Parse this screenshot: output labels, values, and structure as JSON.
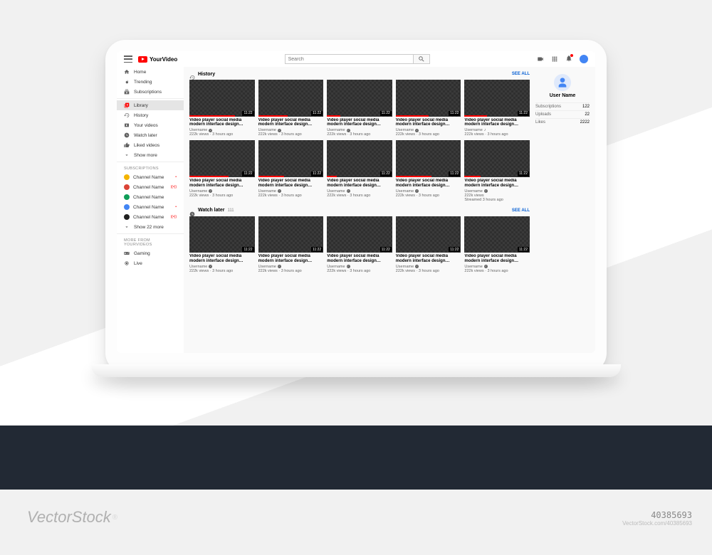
{
  "brand": "YourVideo",
  "search": {
    "placeholder": "Search"
  },
  "nav": {
    "primary": [
      {
        "label": "Home"
      },
      {
        "label": "Trending"
      },
      {
        "label": "Subscriptions"
      }
    ],
    "library_label": "Library",
    "secondary": [
      {
        "label": "History"
      },
      {
        "label": "Your videos"
      },
      {
        "label": "Watch later"
      },
      {
        "label": "Liked videos"
      },
      {
        "label": "Show more"
      }
    ],
    "subs_header": "SUBSCRIPTIONS",
    "subs": [
      {
        "label": "Channel Name",
        "color": "#f4b400",
        "badge": "•"
      },
      {
        "label": "Channel Name",
        "color": "#db4437",
        "badge": "((•))"
      },
      {
        "label": "Channel Name",
        "color": "#0f9d58",
        "badge": ""
      },
      {
        "label": "Channel Name",
        "color": "#4285f4",
        "badge": "•"
      },
      {
        "label": "Channel Name",
        "color": "#202020",
        "badge": "((•))"
      }
    ],
    "show_more_subs": "Show 22 more",
    "more_header": "MORE FROM YOURVIDEOS",
    "more": [
      {
        "label": "Gaming"
      },
      {
        "label": "Live"
      }
    ]
  },
  "sections": {
    "history": {
      "title": "History",
      "see_all": "SEE ALL"
    },
    "watch_later": {
      "title": "Watch later",
      "count": "111",
      "see_all": "SEE ALL"
    }
  },
  "video": {
    "title": "Video player social media modern interface design…",
    "user": "Username",
    "meta": "222k views · 3 hours ago",
    "meta_streamed": "Streamed 3 hours ago",
    "meta_views_only": "222k views",
    "duration": "11:22"
  },
  "progress": [
    70,
    45,
    20,
    50,
    35,
    60,
    40,
    15,
    55,
    25
  ],
  "music_badge": "♪",
  "profile": {
    "name": "User Name",
    "stats": [
      {
        "label": "Subscriptions",
        "value": "122"
      },
      {
        "label": "Uploads",
        "value": "22"
      },
      {
        "label": "Likes",
        "value": "2222"
      }
    ]
  },
  "watermark": {
    "brand": "VectorStock",
    "suffix": "®",
    "id": "40385693",
    "attr": "VectorStock.com/40385693"
  }
}
